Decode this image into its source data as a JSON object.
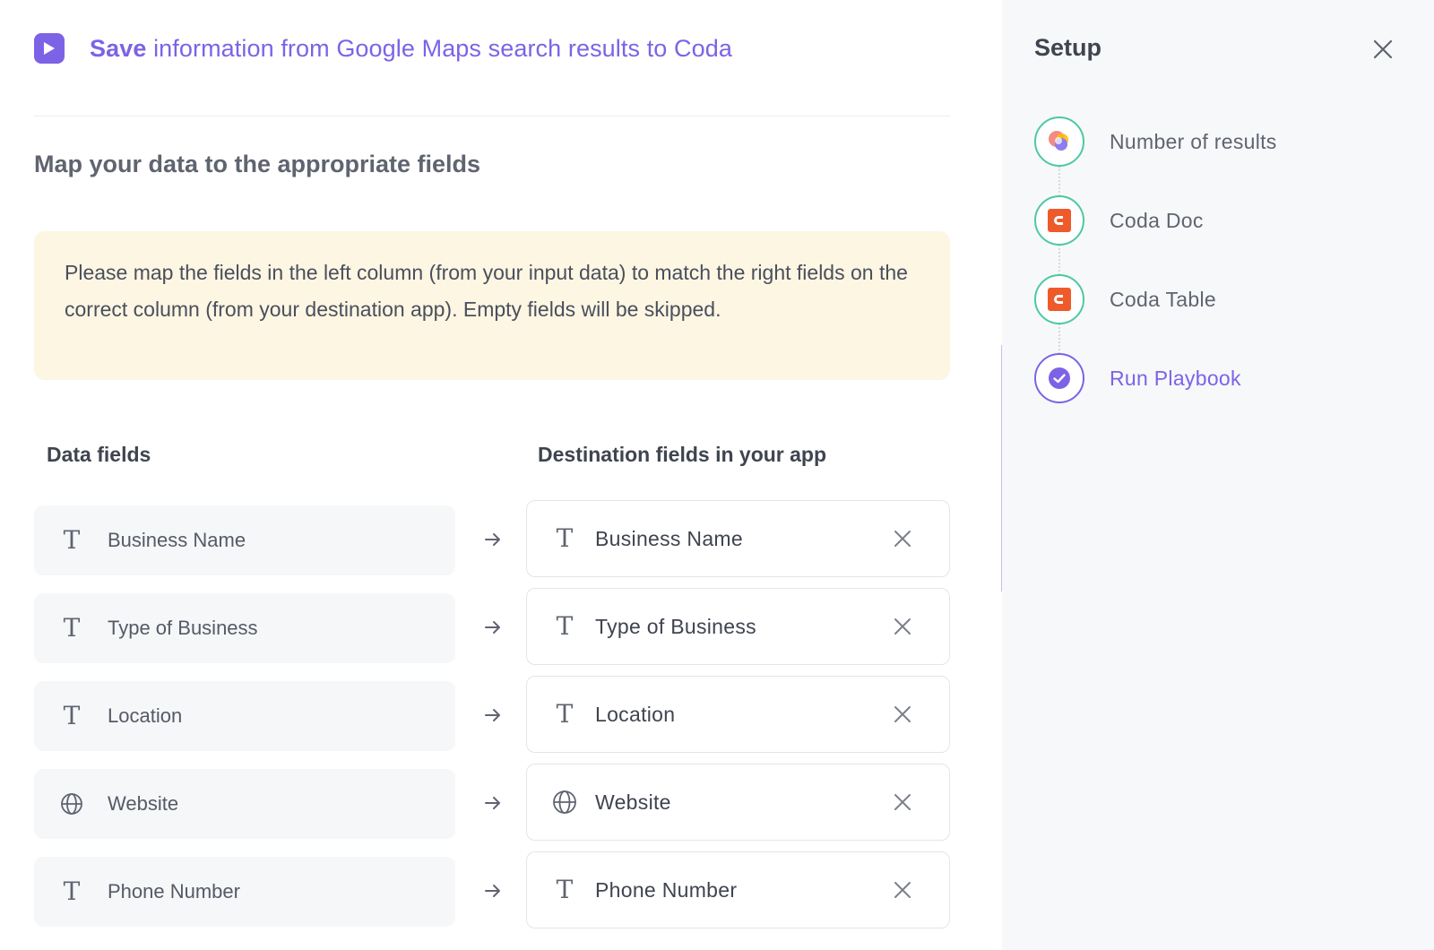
{
  "header": {
    "title_bold": "Save",
    "title_rest": " information from Google Maps search results to Coda",
    "icon": "play-icon"
  },
  "section_title": "Map your data to the appropriate fields",
  "notice": "Please map the fields in the left column (from your input data) to match the right fields on the correct column (from your destination app). Empty fields will be skipped.",
  "columns": {
    "left": "Data fields",
    "right": "Destination fields in your app"
  },
  "rows": [
    {
      "source": "Business Name",
      "destination": "Business Name",
      "type_icon": "text-type-icon"
    },
    {
      "source": "Type of Business",
      "destination": "Type of Business",
      "type_icon": "text-type-icon"
    },
    {
      "source": "Location",
      "destination": "Location",
      "type_icon": "text-type-icon"
    },
    {
      "source": "Website",
      "destination": "Website",
      "type_icon": "globe-icon"
    },
    {
      "source": "Phone Number",
      "destination": "Phone Number",
      "type_icon": "text-type-icon"
    }
  ],
  "sidebar": {
    "title": "Setup",
    "steps": [
      {
        "label": "Number of results",
        "icon": "google-maps-icon",
        "state": "done"
      },
      {
        "label": "Coda Doc",
        "icon": "coda-icon",
        "state": "done"
      },
      {
        "label": "Coda Table",
        "icon": "coda-icon",
        "state": "done"
      },
      {
        "label": "Run Playbook",
        "icon": "check-circle-icon",
        "state": "active"
      }
    ]
  },
  "colors": {
    "accent": "#7c63e6",
    "notice_bg": "#fdf6e3",
    "step_done": "#4cc9a0",
    "coda": "#ee5a29"
  }
}
